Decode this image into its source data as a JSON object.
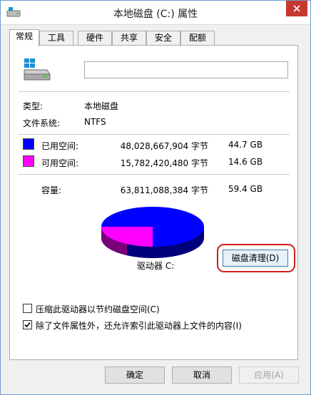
{
  "window": {
    "title": "本地磁盘 (C:) 属性"
  },
  "tabs": [
    {
      "label": "常规",
      "active": true
    },
    {
      "label": "工具",
      "active": false
    },
    {
      "label": "硬件",
      "active": false
    },
    {
      "label": "共享",
      "active": false
    },
    {
      "label": "安全",
      "active": false
    },
    {
      "label": "配额",
      "active": false
    }
  ],
  "general": {
    "name_value": "",
    "type_label": "类型:",
    "type_value": "本地磁盘",
    "fs_label": "文件系统:",
    "fs_value": "NTFS",
    "used": {
      "label": "已用空间:",
      "bytes": "48,028,667,904 字节",
      "size": "44.7 GB",
      "color": "#0000ff"
    },
    "free": {
      "label": "可用空间:",
      "bytes": "15,782,420,480 字节",
      "size": "14.6 GB",
      "color": "#ff00ff"
    },
    "capacity": {
      "label": "容量:",
      "bytes": "63,811,088,384 字节",
      "size": "59.4 GB"
    },
    "drive_label": "驱动器 C:",
    "cleanup_button": "磁盘清理(D)",
    "compress_checkbox": {
      "label": "压缩此驱动器以节约磁盘空间(C)",
      "checked": false
    },
    "index_checkbox": {
      "label": "除了文件属性外，还允许索引此驱动器上文件的内容(I)",
      "checked": true
    }
  },
  "footer": {
    "ok": "确定",
    "cancel": "取消",
    "apply": "应用(A)"
  },
  "colors": {
    "used": "#0000ff",
    "free": "#ff00ff",
    "close_button": "#c7382f",
    "highlight_ring": "#d02020"
  }
}
